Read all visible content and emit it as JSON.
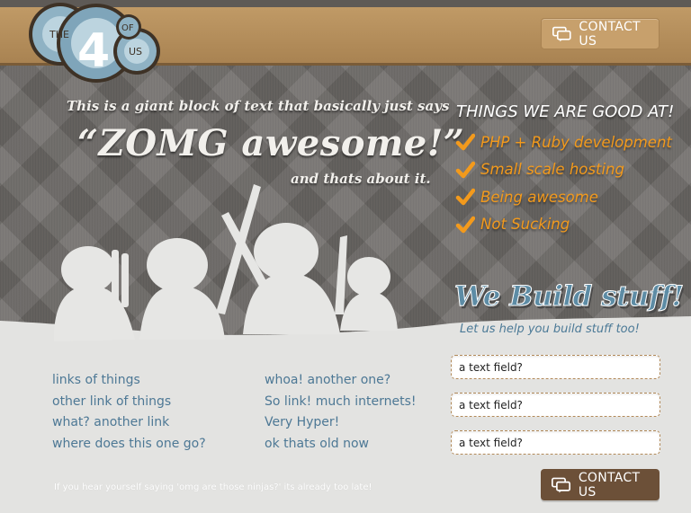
{
  "logo": {
    "the": "THE",
    "number": "4",
    "of": "OF",
    "us": "US"
  },
  "header": {
    "contact_label": "CONTACT US"
  },
  "hero": {
    "line1": "This is a giant block of text that basically just says",
    "line2": "“ZOMG awesome!”",
    "line3": "and thats about it."
  },
  "good_at": {
    "title": "THINGS WE ARE GOOD AT!",
    "items": [
      "PHP + Ruby development",
      "Small scale hosting",
      "Being awesome",
      "Not Sucking"
    ]
  },
  "build": {
    "title": "We Build stuff!",
    "subtitle": "Let us help you build stuff too!"
  },
  "form": {
    "field1_placeholder": "a text field?",
    "field2_placeholder": "a text field?",
    "field3_placeholder": "a text field?",
    "contact_label": "CONTACT US"
  },
  "links_col1": [
    "links of things",
    "other link of things",
    "what? another link",
    "where does this one go?"
  ],
  "links_col2": [
    "whoa! another one?",
    "So link! much internets!",
    "Very Hyper!",
    "ok thats old now"
  ],
  "footer": {
    "note": "If you hear yourself saying 'omg are those ninjas?' its already too late!"
  },
  "colors": {
    "accent_orange": "#f39a1c",
    "header_tan": "#b8915e",
    "link_blue": "#4d7895",
    "button_brown": "#6c5038"
  },
  "icons": {
    "contact": "speech-bubbles-icon",
    "check": "checkmark-icon"
  }
}
